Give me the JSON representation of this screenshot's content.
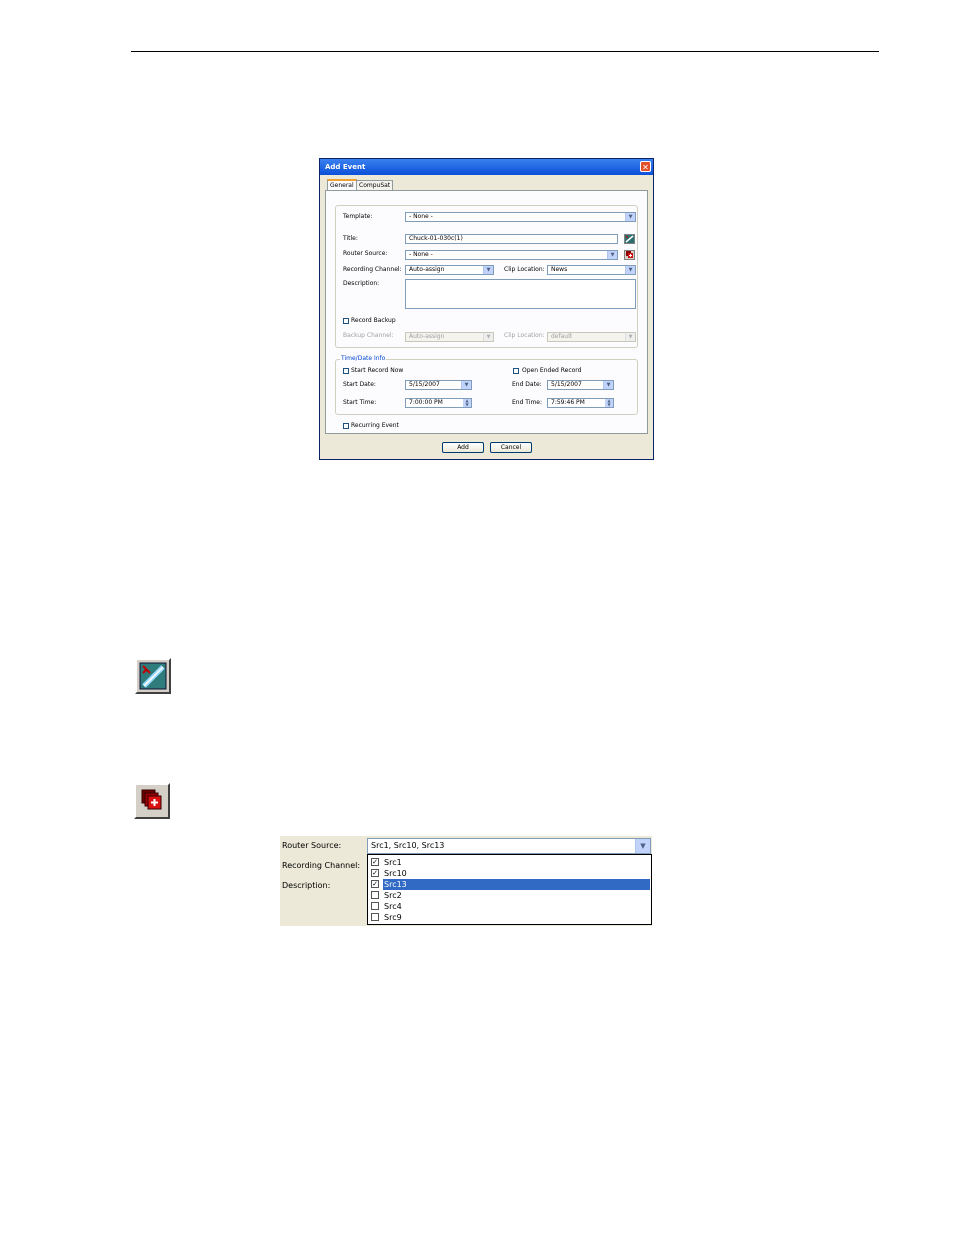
{
  "dialog": {
    "title": "Add Event",
    "close_glyph": "✕",
    "tabs": [
      {
        "label": "General",
        "active": true
      },
      {
        "label": "CompuSat",
        "active": false
      }
    ],
    "template_label": "Template:",
    "template_value": "- None -",
    "title_label": "Title:",
    "title_value": "Chuck-01-030c(1)",
    "router_source_label": "Router Source:",
    "router_source_value": "- None -",
    "recording_channel_label": "Recording Channel:",
    "recording_channel_value": "Auto-assign",
    "clip_location_label": "Clip Location:",
    "clip_location_value": "News",
    "description_label": "Description:",
    "description_value": "",
    "record_backup_label": "Record Backup",
    "backup_channel_label": "Backup Channel:",
    "backup_channel_value": "Auto-assign",
    "backup_clip_location_label": "Clip Location:",
    "backup_clip_location_value": "default",
    "time_group_label": "Time/Date Info",
    "start_record_now_label": "Start Record Now",
    "open_ended_record_label": "Open Ended Record",
    "start_date_label": "Start Date:",
    "start_date_value": "5/15/2007",
    "end_date_label": "End Date:",
    "end_date_value": "5/15/2007",
    "start_time_label": "Start Time:",
    "start_time_value": "7:00:00 PM",
    "end_time_label": "End Time:",
    "end_time_value": "7:59:46 PM",
    "recurring_event_label": "Recurring Event",
    "add_label": "Add",
    "cancel_label": "Cancel",
    "icons": {
      "title_button": "rename-icon",
      "router_button": "multi-source-icon"
    }
  },
  "standalone_icons": [
    "rename-icon",
    "multi-source-icon"
  ],
  "router_dropdown": {
    "router_source_label": "Router Source:",
    "recording_channel_label": "Recording Channel:",
    "description_label": "Description:",
    "value": "Src1, Src10, Src13",
    "items": [
      {
        "label": "Src1",
        "checked": true,
        "selected": false
      },
      {
        "label": "Src10",
        "checked": true,
        "selected": false
      },
      {
        "label": "Src13",
        "checked": true,
        "selected": true
      },
      {
        "label": "Src2",
        "checked": false,
        "selected": false
      },
      {
        "label": "Src4",
        "checked": false,
        "selected": false
      },
      {
        "label": "Src9",
        "checked": false,
        "selected": false
      }
    ]
  },
  "colors": {
    "titlebar": "#0a4fd8",
    "selection": "#316ac5",
    "dialog_bg": "#ece9d8"
  }
}
